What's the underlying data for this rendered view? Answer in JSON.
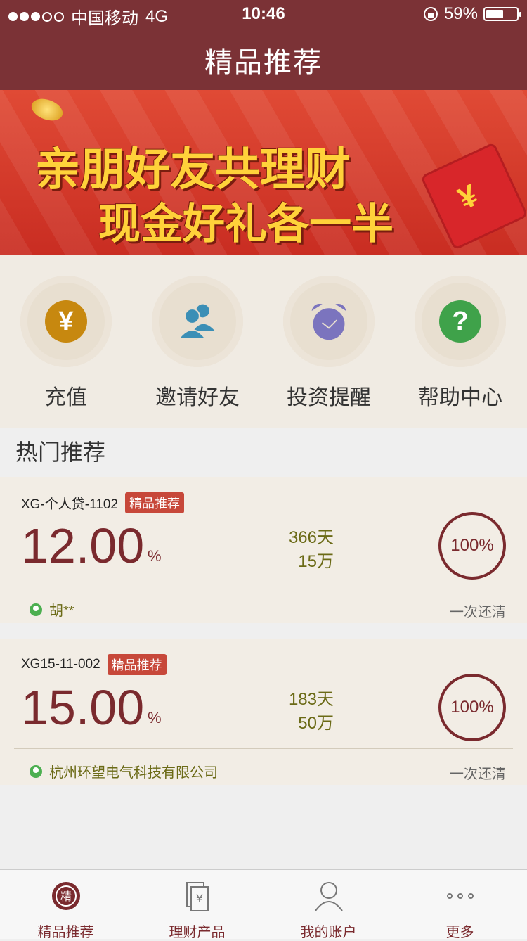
{
  "status": {
    "carrier": "中国移动",
    "network": "4G",
    "time": "10:46",
    "battery": "59%"
  },
  "header": {
    "title": "精品推荐"
  },
  "banner": {
    "line1": "亲朋好友共理财",
    "line2": "现金好礼各一半",
    "page_count": 3,
    "active_page": 2
  },
  "quick": [
    {
      "label": "充值",
      "icon": "yen-icon",
      "color": "#c7880f"
    },
    {
      "label": "邀请好友",
      "icon": "invite-friends-icon",
      "color": "#3b8fb6"
    },
    {
      "label": "投资提醒",
      "icon": "alarm-clock-icon",
      "color": "#7b74be"
    },
    {
      "label": "帮助中心",
      "icon": "help-icon",
      "color": "#3fa24a"
    }
  ],
  "hot": {
    "title": "热门推荐"
  },
  "products": [
    {
      "name": "XG-个人贷-1102",
      "badge": "精品推荐",
      "rate": "12.00",
      "pct": "%",
      "days": "366天",
      "amount": "15万",
      "progress": "100%",
      "owner": "胡**",
      "repay": "一次还清"
    },
    {
      "name": "XG15-11-002",
      "badge": "精品推荐",
      "rate": "15.00",
      "pct": "%",
      "days": "183天",
      "amount": "50万",
      "progress": "100%",
      "owner": "杭州环望电气科技有限公司",
      "repay": "一次还清"
    }
  ],
  "tabs": [
    {
      "label": "精品推荐",
      "icon": "featured-icon"
    },
    {
      "label": "理财产品",
      "icon": "document-icon"
    },
    {
      "label": "我的账户",
      "icon": "user-icon"
    },
    {
      "label": "更多",
      "icon": "more-icon"
    }
  ]
}
